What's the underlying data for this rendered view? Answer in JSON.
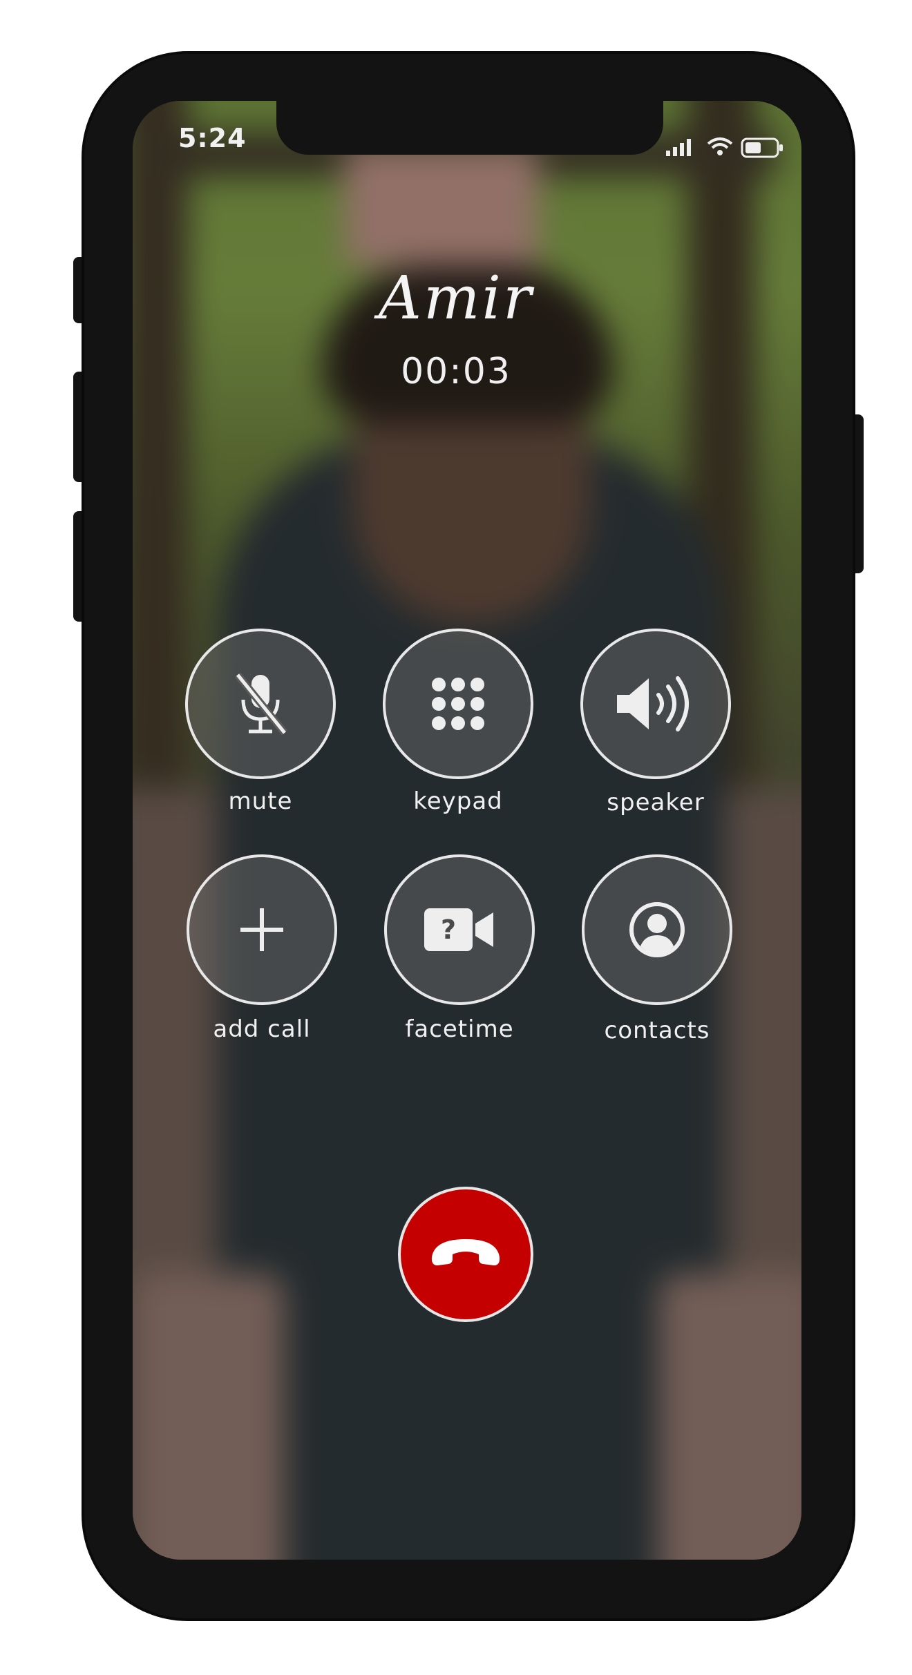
{
  "status_bar": {
    "time": "5:24"
  },
  "call": {
    "contact_name": "Amir",
    "duration": "00:03"
  },
  "controls": [
    {
      "label": "mute",
      "icon": "mic-slash-icon"
    },
    {
      "label": "keypad",
      "icon": "keypad-icon"
    },
    {
      "label": "speaker",
      "icon": "speaker-icon"
    },
    {
      "label": "add call",
      "icon": "plus-icon"
    },
    {
      "label": "facetime",
      "icon": "video-camera-icon"
    },
    {
      "label": "contacts",
      "icon": "person-circle-icon"
    }
  ],
  "end_call": {
    "icon": "phone-hangup-icon",
    "color": "#c40000"
  }
}
